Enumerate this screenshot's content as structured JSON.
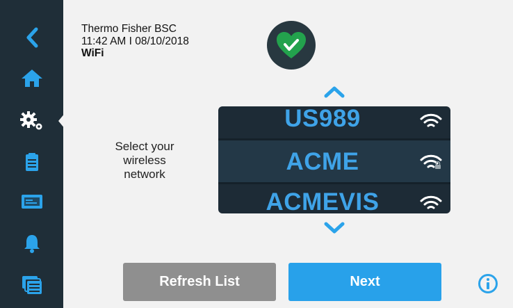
{
  "header": {
    "device_name": "Thermo Fisher BSC",
    "time_date": "11:42 AM I 08/10/2018",
    "screen_title": "WiFi"
  },
  "status": {
    "icon": "heart-check-icon",
    "color": "#23a24d"
  },
  "sidebar": {
    "items": [
      {
        "icon": "back-icon"
      },
      {
        "icon": "home-icon"
      },
      {
        "icon": "settings-icon",
        "active": true
      },
      {
        "icon": "clipboard-icon"
      },
      {
        "icon": "display-icon"
      },
      {
        "icon": "bell-icon"
      },
      {
        "icon": "stack-icon"
      }
    ]
  },
  "prompt": {
    "line1": "Select your",
    "line2": "wireless",
    "line3": "network"
  },
  "networks": [
    {
      "ssid": "US989",
      "secured": false
    },
    {
      "ssid": "ACME",
      "secured": true,
      "selected": true
    },
    {
      "ssid": "ACMEVIS",
      "secured": false
    }
  ],
  "buttons": {
    "refresh_label": "Refresh List",
    "next_label": "Next"
  },
  "colors": {
    "sidebar": "#1f2e38",
    "accent": "#3fa3e8",
    "next_button": "#28a1ea",
    "refresh_button": "#8f8f8f",
    "picker_bg": "#1d2b36"
  }
}
